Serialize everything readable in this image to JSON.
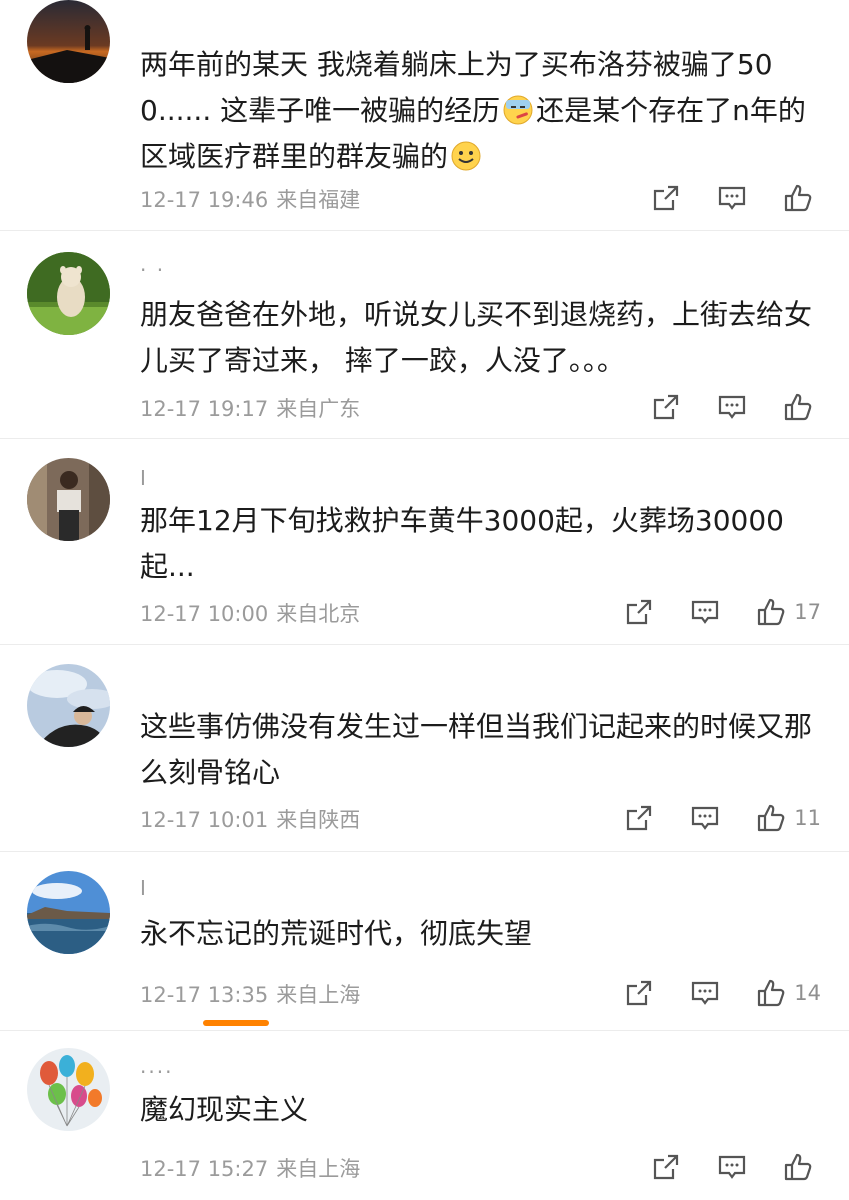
{
  "comments": [
    {
      "username": "",
      "text_before": "两年前的某天 我烧着躺床上为了买布洛芬被骗了500...... 这辈子唯一被骗的经历",
      "emoji_1": "sick-face-emoji",
      "text_middle": "还是某个存在了n年的区域医疗群里的群友骗的",
      "emoji_2": "smile-emoji",
      "time": "12-17 19:46",
      "location": "来自福建",
      "likes": ""
    },
    {
      "username": "· ·",
      "text": "朋友爸爸在外地，听说女儿买不到退烧药，上街去给女儿买了寄过来， 摔了一跤，人没了。。。",
      "time": "12-17 19:17",
      "location": "来自广东",
      "likes": ""
    },
    {
      "username": "I",
      "text": "那年12月下旬找救护车黄牛3000起，火葬场30000起...",
      "time": "12-17 10:00",
      "location": "来自北京",
      "likes": "17"
    },
    {
      "username": "",
      "text": "这些事仿佛没有发生过一样但当我们记起来的时候又那么刻骨铭心",
      "time": "12-17 10:01",
      "location": "来自陕西",
      "likes": "11"
    },
    {
      "username": "I",
      "text": "永不忘记的荒诞时代，彻底失望",
      "time": "12-17 13:35",
      "location": "来自上海",
      "likes": "14"
    },
    {
      "username": "....",
      "text": "魔幻现实主义",
      "time": "12-17 15:27",
      "location": "来自上海",
      "likes": ""
    }
  ],
  "colors": {
    "accent": "#ff8200",
    "meta": "#9b9b9b",
    "text": "#1c1c1c"
  }
}
